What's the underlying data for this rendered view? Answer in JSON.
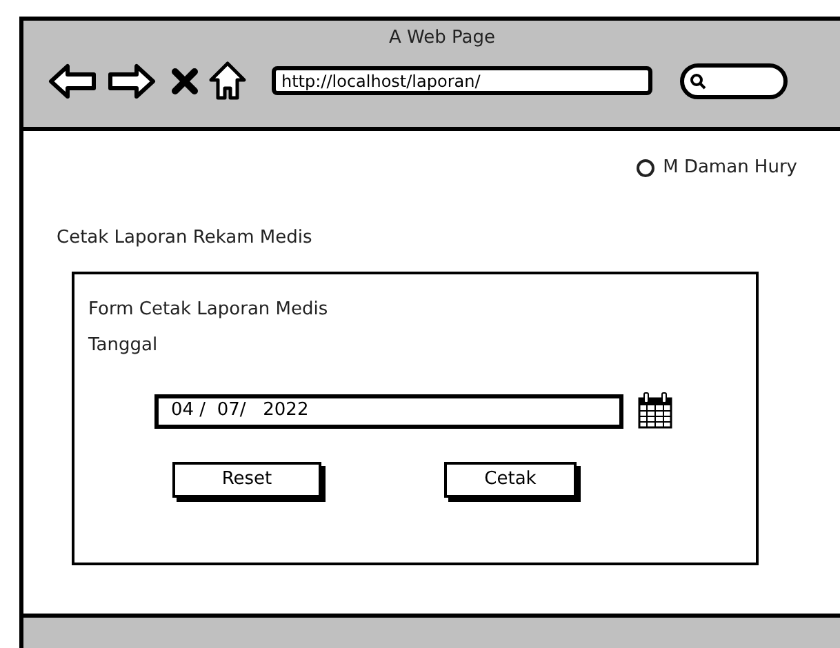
{
  "window": {
    "title": "A Web Page"
  },
  "browser": {
    "address": "http://localhost/laporan/"
  },
  "user": {
    "name": "M Daman Hury"
  },
  "page_title": "Cetak Laporan Rekam Medis",
  "form": {
    "title": "Form Cetak Laporan Medis",
    "date_label": "Tanggal",
    "date_value": "04 /  07/   2022",
    "buttons": [
      {
        "label": "Reset"
      },
      {
        "label": "Cetak"
      }
    ]
  }
}
